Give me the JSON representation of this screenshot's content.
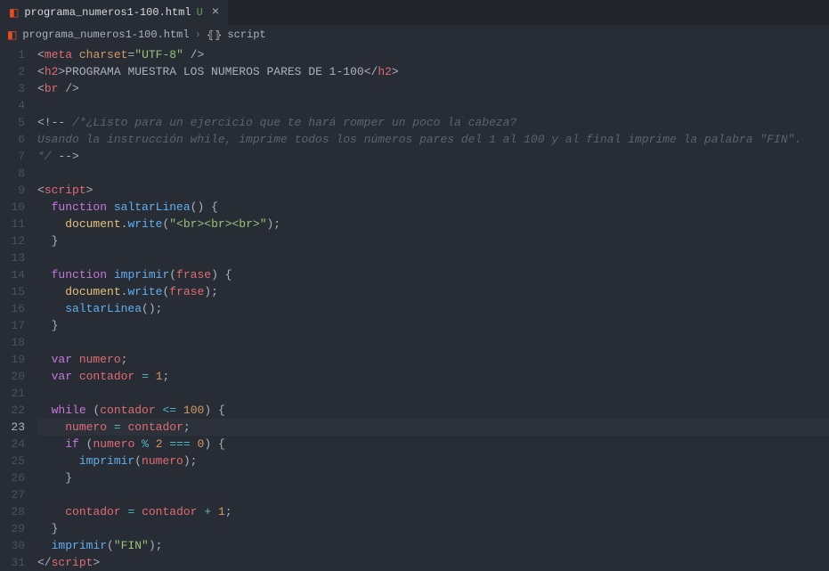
{
  "tab": {
    "filename": "programa_numeros1-100.html",
    "modified_marker": "U"
  },
  "breadcrumbs": {
    "file": "programa_numeros1-100.html",
    "symbol": "script"
  },
  "active_line": 23,
  "line_count": 31,
  "code": {
    "l1": {
      "charset_attr": "charset",
      "charset_val": "\"UTF-8\"",
      "meta": "meta",
      "slash": "/>"
    },
    "l2": {
      "h2": "h2",
      "text": "PROGRAMA MUESTRA LOS NUMEROS PARES DE 1-100"
    },
    "l3": {
      "br": "br"
    },
    "l5": {
      "open": "<!--",
      "text": " /*¿Listo para un ejercicio que te hará romper un poco la cabeza?"
    },
    "l6": {
      "text": "Usando la instrucción while, imprime todos los números pares del 1 al 100 y al final imprime la palabra \"FIN\"."
    },
    "l7": {
      "text": "*/ ",
      "close": "-->"
    },
    "l9": {
      "script": "script"
    },
    "l10": {
      "fn_kw": "function",
      "name": "saltarLinea"
    },
    "l11": {
      "obj": "document",
      "method": "write",
      "arg": "\"<br><br><br>\""
    },
    "l14": {
      "fn_kw": "function",
      "name": "imprimir",
      "param": "frase"
    },
    "l15": {
      "obj": "document",
      "method": "write",
      "arg": "frase"
    },
    "l16": {
      "call": "saltarLinea"
    },
    "l19": {
      "kw": "var",
      "name": "numero"
    },
    "l20": {
      "kw": "var",
      "name": "contador",
      "val": "1"
    },
    "l22": {
      "kw": "while",
      "var": "contador",
      "op": "<=",
      "num": "100"
    },
    "l23": {
      "lhs": "numero",
      "rhs": "contador"
    },
    "l24": {
      "kw": "if",
      "var": "numero",
      "op1": "%",
      "n1": "2",
      "op2": "===",
      "n2": "0"
    },
    "l25": {
      "call": "imprimir",
      "arg": "numero"
    },
    "l28": {
      "lhs": "contador",
      "rhs": "contador",
      "op": "+",
      "n": "1"
    },
    "l30": {
      "call": "imprimir",
      "arg": "\"FIN\""
    },
    "l31": {
      "script": "script"
    }
  }
}
